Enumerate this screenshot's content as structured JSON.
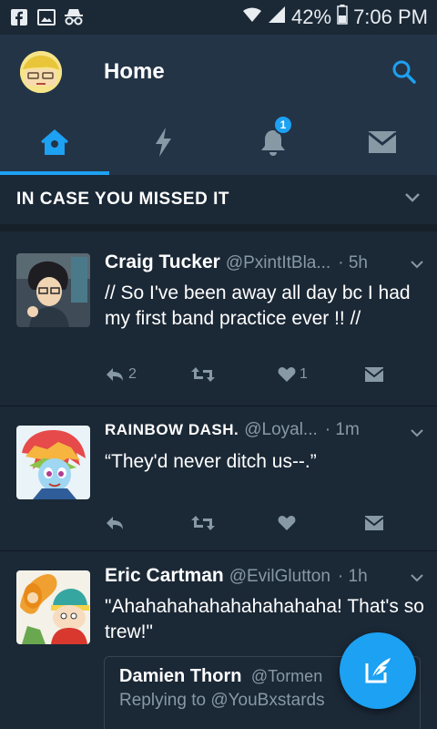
{
  "status_bar": {
    "icons_left": [
      "facebook-icon",
      "image-icon",
      "incognito-icon"
    ],
    "battery_pct": "42%",
    "time": "7:06 PM"
  },
  "app_bar": {
    "title": "Home",
    "search_icon": "search-icon"
  },
  "tabs": [
    {
      "name": "home",
      "icon": "home-icon",
      "active": true
    },
    {
      "name": "moments",
      "icon": "lightning-icon",
      "active": false
    },
    {
      "name": "notifications",
      "icon": "bell-icon",
      "active": false,
      "badge": "1"
    },
    {
      "name": "messages",
      "icon": "envelope-icon",
      "active": false
    }
  ],
  "section": {
    "title": "IN CASE YOU MISSED IT"
  },
  "tweets": [
    {
      "name": "Craig Tucker",
      "handle": "@PxintItBla...",
      "time": "· 5h",
      "text": "// So I've been away all day bc I had my first band practice ever !! //",
      "reply_count": "2",
      "retweet_count": "",
      "like_count": "1"
    },
    {
      "name": "RAINBOW DASH.",
      "handle": "@Loyal...",
      "time": "· 1m",
      "text": "“They'd never ditch us--.”",
      "reply_count": "",
      "retweet_count": "",
      "like_count": ""
    },
    {
      "name": "Eric Cartman",
      "handle": "@EvilGlutton",
      "time": "· 1h",
      "text": "\"Ahahahahahahahahahaha! That's so trew!\"",
      "quote": {
        "name": "Damien Thorn",
        "handle": "@Tormen",
        "reply_line": "Replying to @YouBxstards"
      }
    }
  ],
  "colors": {
    "background": "#1b2836",
    "bar": "#243447",
    "accent": "#1da1f2",
    "muted": "#8899a6"
  },
  "fab": {
    "icon": "compose-tweet-icon"
  }
}
